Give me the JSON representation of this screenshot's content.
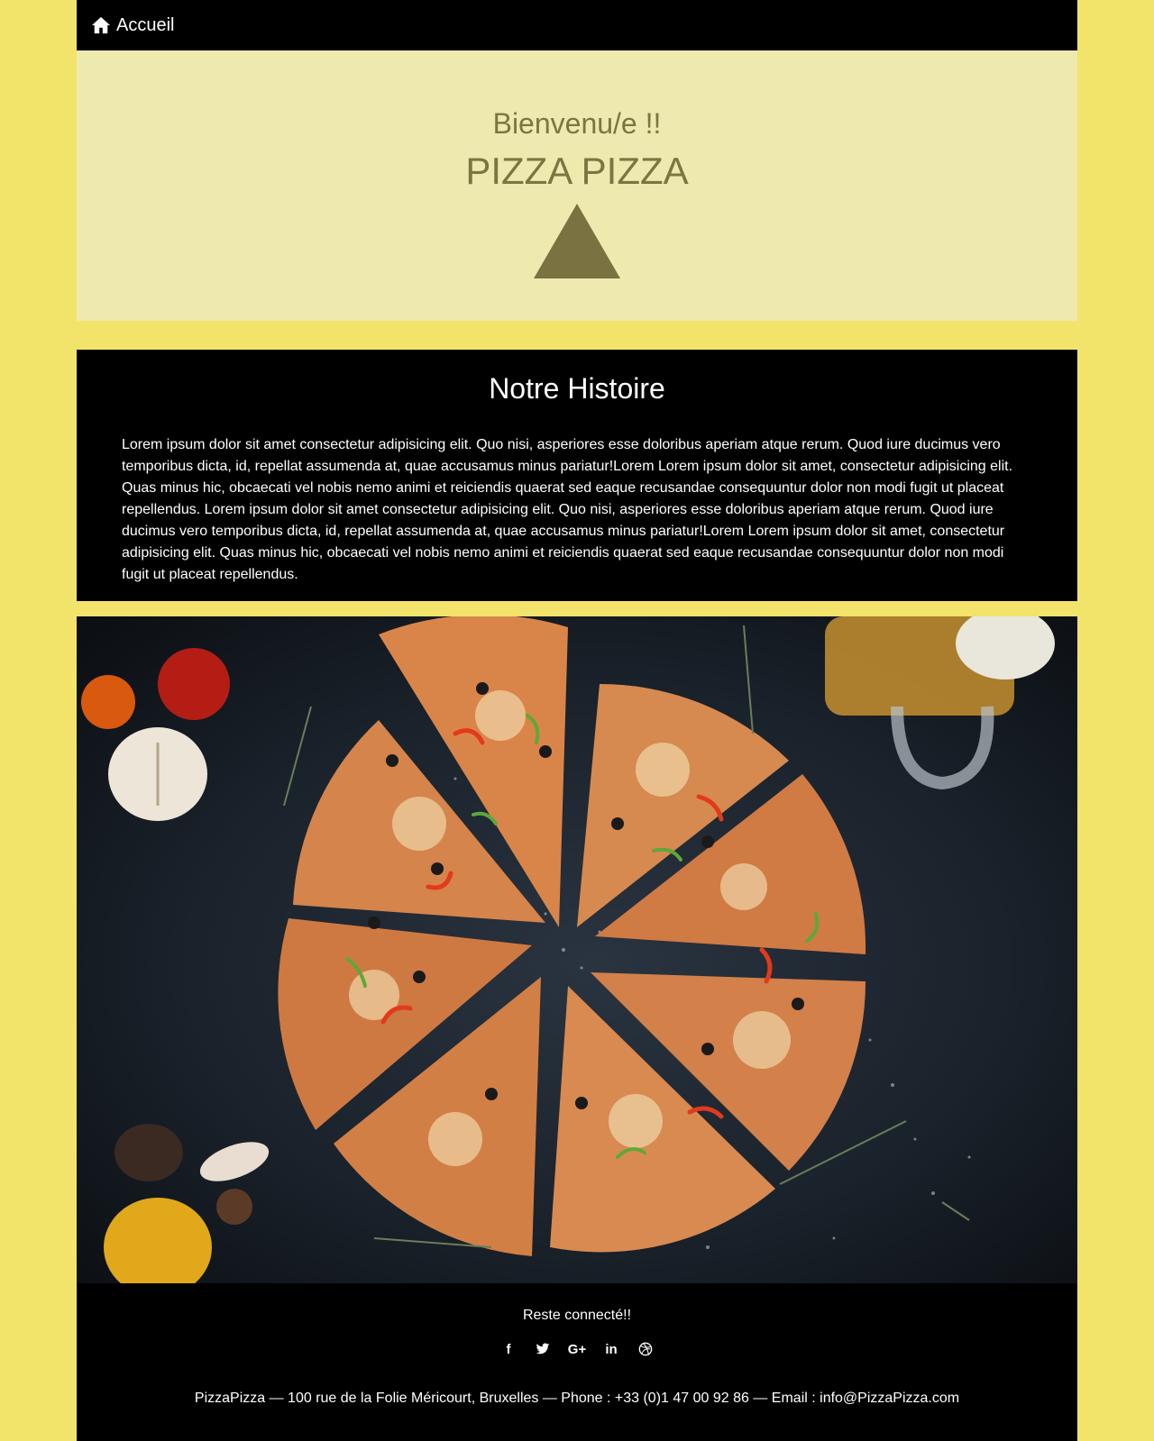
{
  "nav": {
    "home_label": "Accueil",
    "home_icon": "home-icon"
  },
  "hero": {
    "greeting": "Bienvenu/e !!",
    "title": "PIZZA PIZZA",
    "arrow_icon": "triangle-up-icon"
  },
  "story": {
    "heading": "Notre Histoire",
    "body": "Lorem ipsum dolor sit amet consectetur adipisicing elit. Quo nisi, asperiores esse doloribus aperiam atque rerum. Quod iure ducimus vero temporibus dicta, id, repellat assumenda at, quae accusamus minus pariatur!Lorem Lorem ipsum dolor sit amet, consectetur adipisicing elit. Quas minus hic, obcaecati vel nobis nemo animi et reiciendis quaerat sed eaque recusandae consequuntur dolor non modi fugit ut placeat repellendus. Lorem ipsum dolor sit amet consectetur adipisicing elit. Quo nisi, asperiores esse doloribus aperiam atque rerum. Quod iure ducimus vero temporibus dicta, id, repellat assumenda at, quae accusamus minus pariatur!Lorem Lorem ipsum dolor sit amet, consectetur adipisicing elit. Quas minus hic, obcaecati vel nobis nemo animi et reiciendis quaerat sed eaque recusandae consequuntur dolor non modi fugit ut placeat repellendus."
  },
  "footer": {
    "tagline": "Reste connecté!!",
    "social": {
      "facebook": "f",
      "google_plus": "G+",
      "linkedin": "in"
    },
    "social_icons": [
      "facebook-icon",
      "twitter-icon",
      "google-plus-icon",
      "linkedin-icon",
      "dribbble-icon"
    ],
    "contact": "PizzaPizza — 100 rue de la Folie Méricourt, Bruxelles — Phone : +33 (0)1 47 00 92 86 — Email : info@PizzaPizza.com"
  },
  "colors": {
    "page_bg": "#f2e36b",
    "hero_bg": "#eee9ae",
    "hero_text": "#7b7641",
    "dark": "#000000"
  }
}
